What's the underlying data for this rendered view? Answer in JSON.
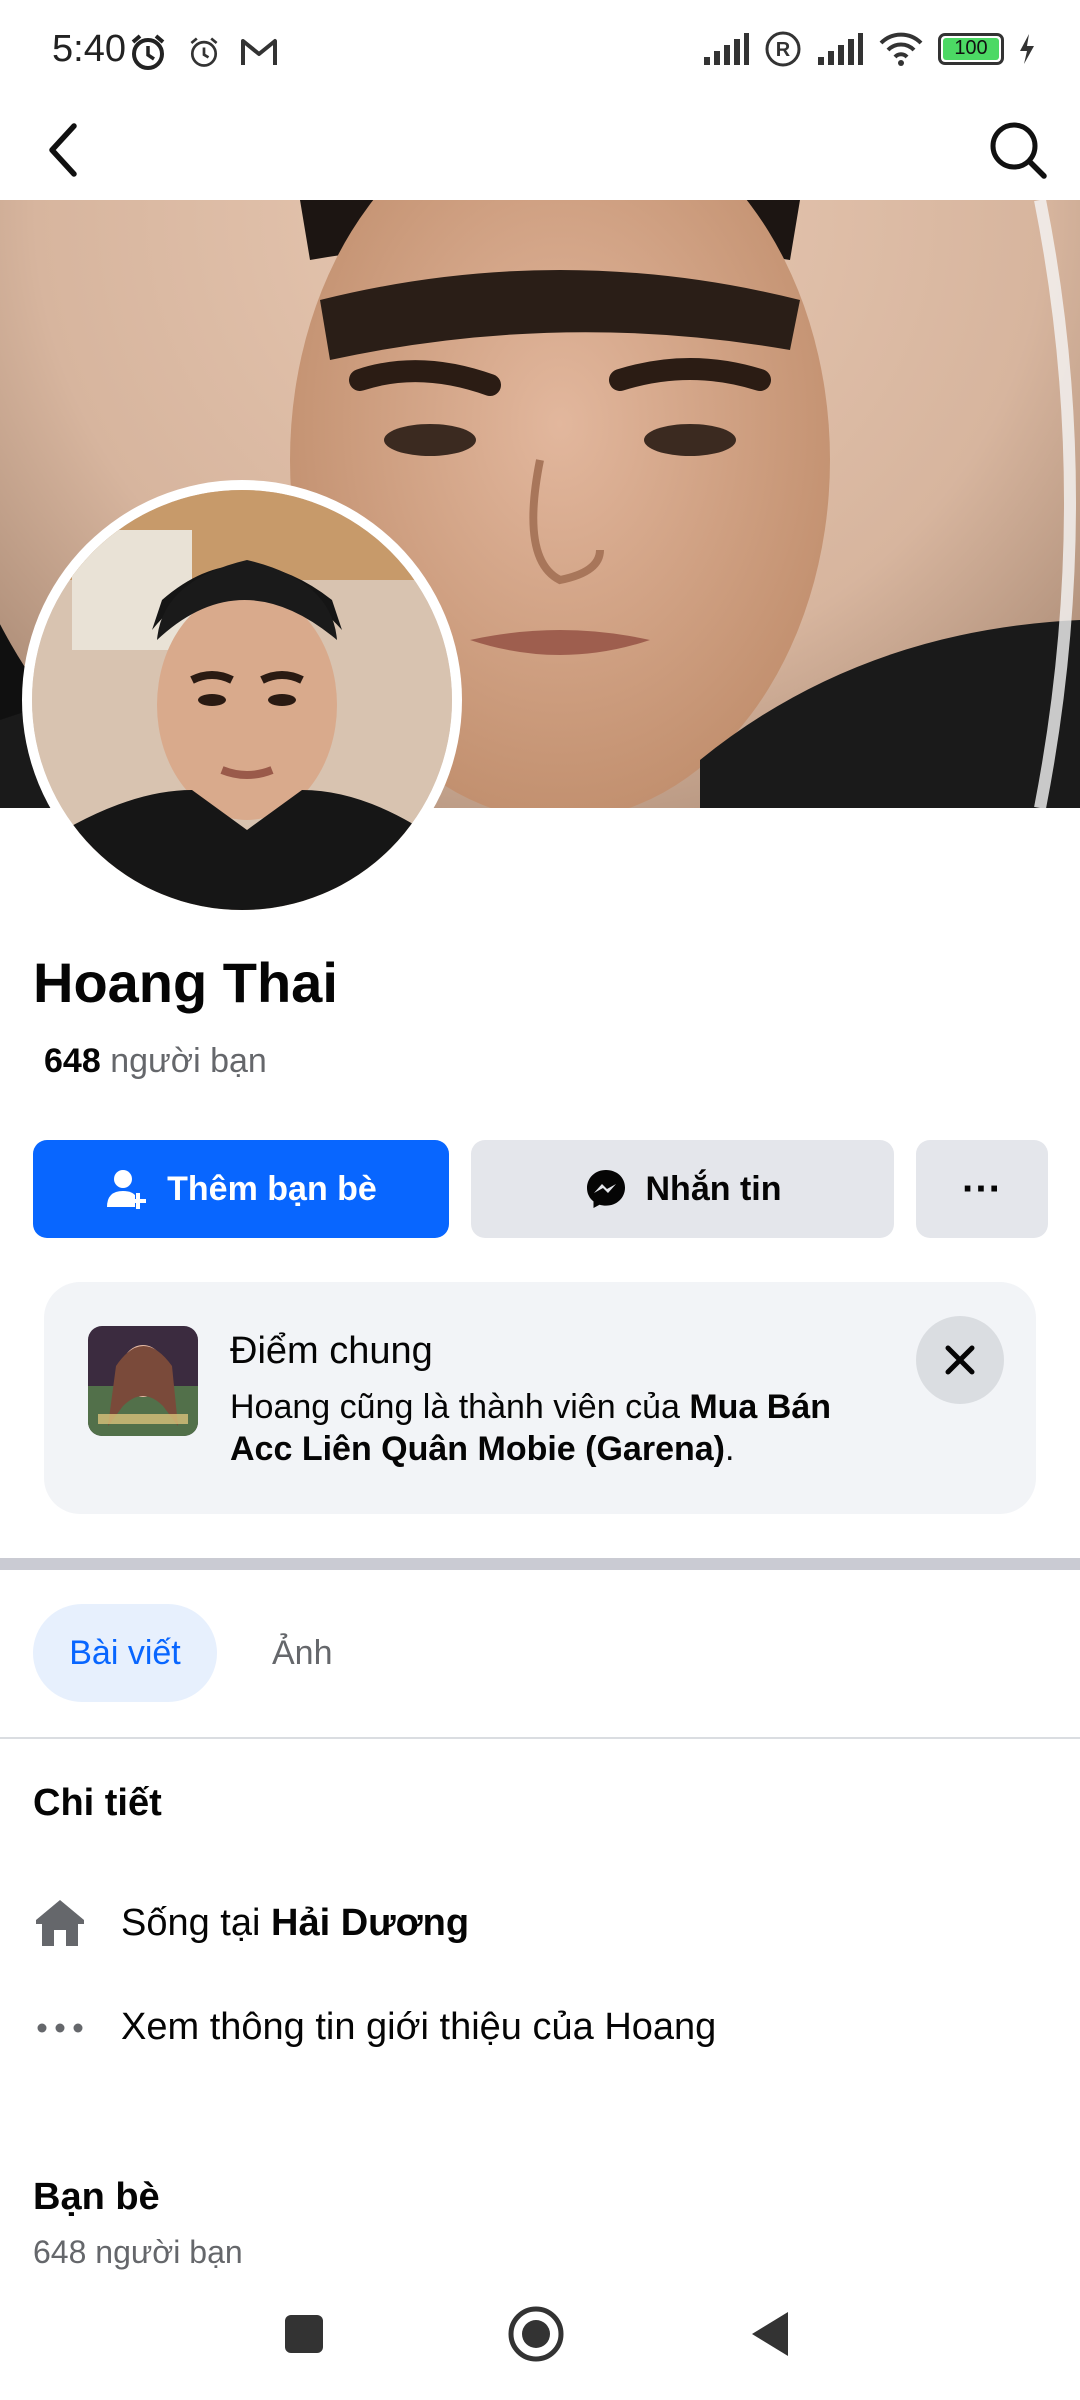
{
  "status_bar": {
    "time": "5:40",
    "left_icons": [
      "alarm-clock-icon",
      "alarm-icon",
      "gmail-icon"
    ],
    "right_icons": [
      "signal-icon",
      "roaming-icon",
      "signal-icon",
      "wifi-icon",
      "battery-icon",
      "charging-icon"
    ],
    "battery": "100"
  },
  "nav": {
    "back_icon": "chevron-left-icon",
    "search_icon": "search-icon"
  },
  "profile": {
    "name": "Hoang Thai",
    "friends_count": "648",
    "friends_suffix": "người bạn"
  },
  "actions": {
    "add_friend": "Thêm bạn bè",
    "message": "Nhắn tin",
    "more": "···"
  },
  "mutual": {
    "title": "Điểm chung",
    "desc_prefix": "Hoang cũng là thành viên của ",
    "group_name": "Mua Bán Acc Liên Quân Mobie (Garena)",
    "desc_suffix": "."
  },
  "tabs": [
    {
      "label": "Bài viết",
      "active": true
    },
    {
      "label": "Ảnh",
      "active": false
    }
  ],
  "details": {
    "title": "Chi tiết",
    "lives_prefix": "Sống tại ",
    "lives_place": "Hải Dương",
    "see_about": "Xem thông tin giới thiệu của Hoang"
  },
  "friends_section": {
    "title": "Bạn bè",
    "count_text": "648 người bạn"
  },
  "colors": {
    "primary": "#0866ff",
    "secondary_bg": "#e4e6eb",
    "muted_text": "#65676b"
  }
}
